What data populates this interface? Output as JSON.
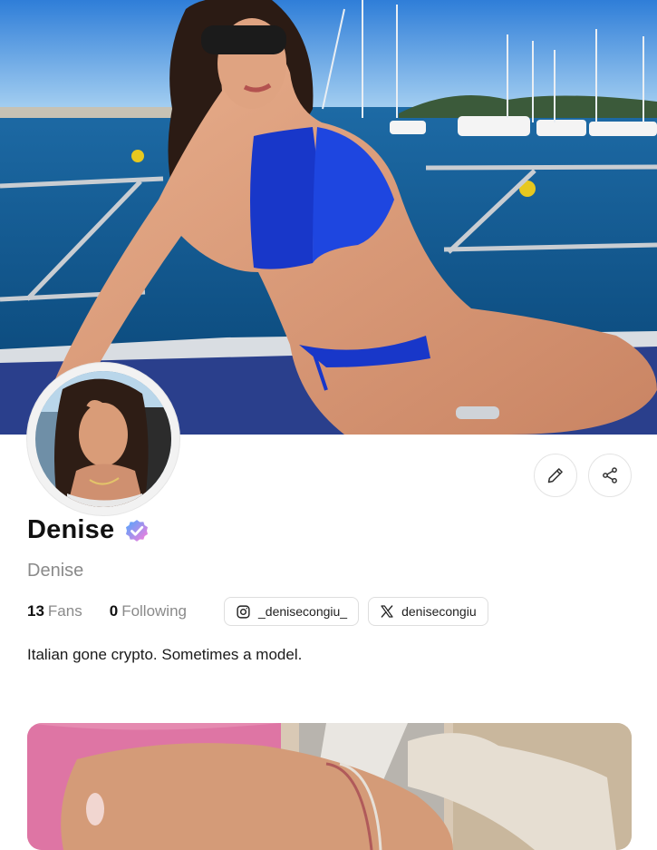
{
  "profile": {
    "display_name": "Denise",
    "username": "Denise",
    "verified": true,
    "bio": "Italian gone crypto. Sometimes a model."
  },
  "stats": {
    "fans_count": "13",
    "fans_label": "Fans",
    "following_count": "0",
    "following_label": "Following"
  },
  "socials": {
    "instagram": "_denisecongiu_",
    "x": "denisecongiu"
  },
  "icons": {
    "edit": "pencil-icon",
    "share": "share-icon",
    "verified": "verified-badge-icon",
    "instagram": "instagram-icon",
    "x": "x-logo-icon"
  },
  "colors": {
    "text_primary": "#111111",
    "text_muted": "#8a8a8a",
    "border": "#e3e3e3",
    "verified_blue": "#4aa8ff",
    "verified_pink": "#ff7ad9"
  }
}
